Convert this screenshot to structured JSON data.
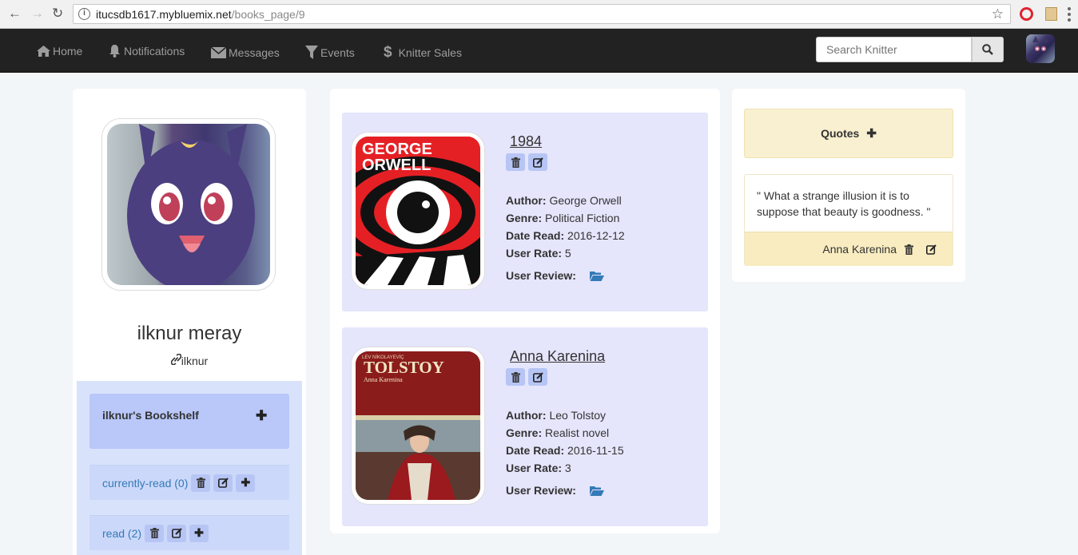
{
  "browser": {
    "url_host": "itucsdb1617.mybluemix.net",
    "url_path": "/books_page/9"
  },
  "navbar": {
    "items": [
      {
        "label": "Home",
        "icon": "home-icon"
      },
      {
        "label": "Notifications",
        "icon": "bell-icon"
      },
      {
        "label": "Messages",
        "icon": "envelope-icon"
      },
      {
        "label": "Events",
        "icon": "filter-icon"
      },
      {
        "label": "Knitter Sales",
        "icon": "dollar-icon"
      }
    ],
    "search_placeholder": "Search Knitter"
  },
  "profile": {
    "name": "ilknur meray",
    "username": "ilknur",
    "bookshelf_title": "ilknur's Bookshelf",
    "shelves": [
      {
        "label": "currently-read (0)"
      },
      {
        "label": "read (2)"
      }
    ]
  },
  "books": [
    {
      "title": "1984",
      "author_label": "Author:",
      "author": "George Orwell",
      "genre_label": "Genre:",
      "genre": "Political Fiction",
      "date_label": "Date Read:",
      "date": "2016-12-12",
      "rate_label": "User Rate:",
      "rate": "5",
      "review_label": "User Review:"
    },
    {
      "title": "Anna Karenina",
      "author_label": "Author:",
      "author": "Leo Tolstoy",
      "genre_label": "Genre:",
      "genre": "Realist novel",
      "date_label": "Date Read:",
      "date": "2016-11-15",
      "rate_label": "User Rate:",
      "rate": "3",
      "review_label": "User Review:"
    }
  ],
  "covers": {
    "orwell_line1": "GEORGE",
    "orwell_line2": "ORWELL",
    "tolstoy_top": "LEV NİKOLAYEVİÇ",
    "tolstoy_name": "TOLSTOY",
    "tolstoy_sub": "Anna Karenina"
  },
  "quotes": {
    "title": "Quotes",
    "items": [
      {
        "text": "\" What a strange illusion it is to suppose that beauty is goodness. \"",
        "book": "Anna Karenina"
      }
    ]
  },
  "colors": {
    "navbar": "#222222",
    "accent_link": "#337ab7",
    "book_card": "#e5e5fc",
    "quote_bg": "#f8ecc0"
  }
}
